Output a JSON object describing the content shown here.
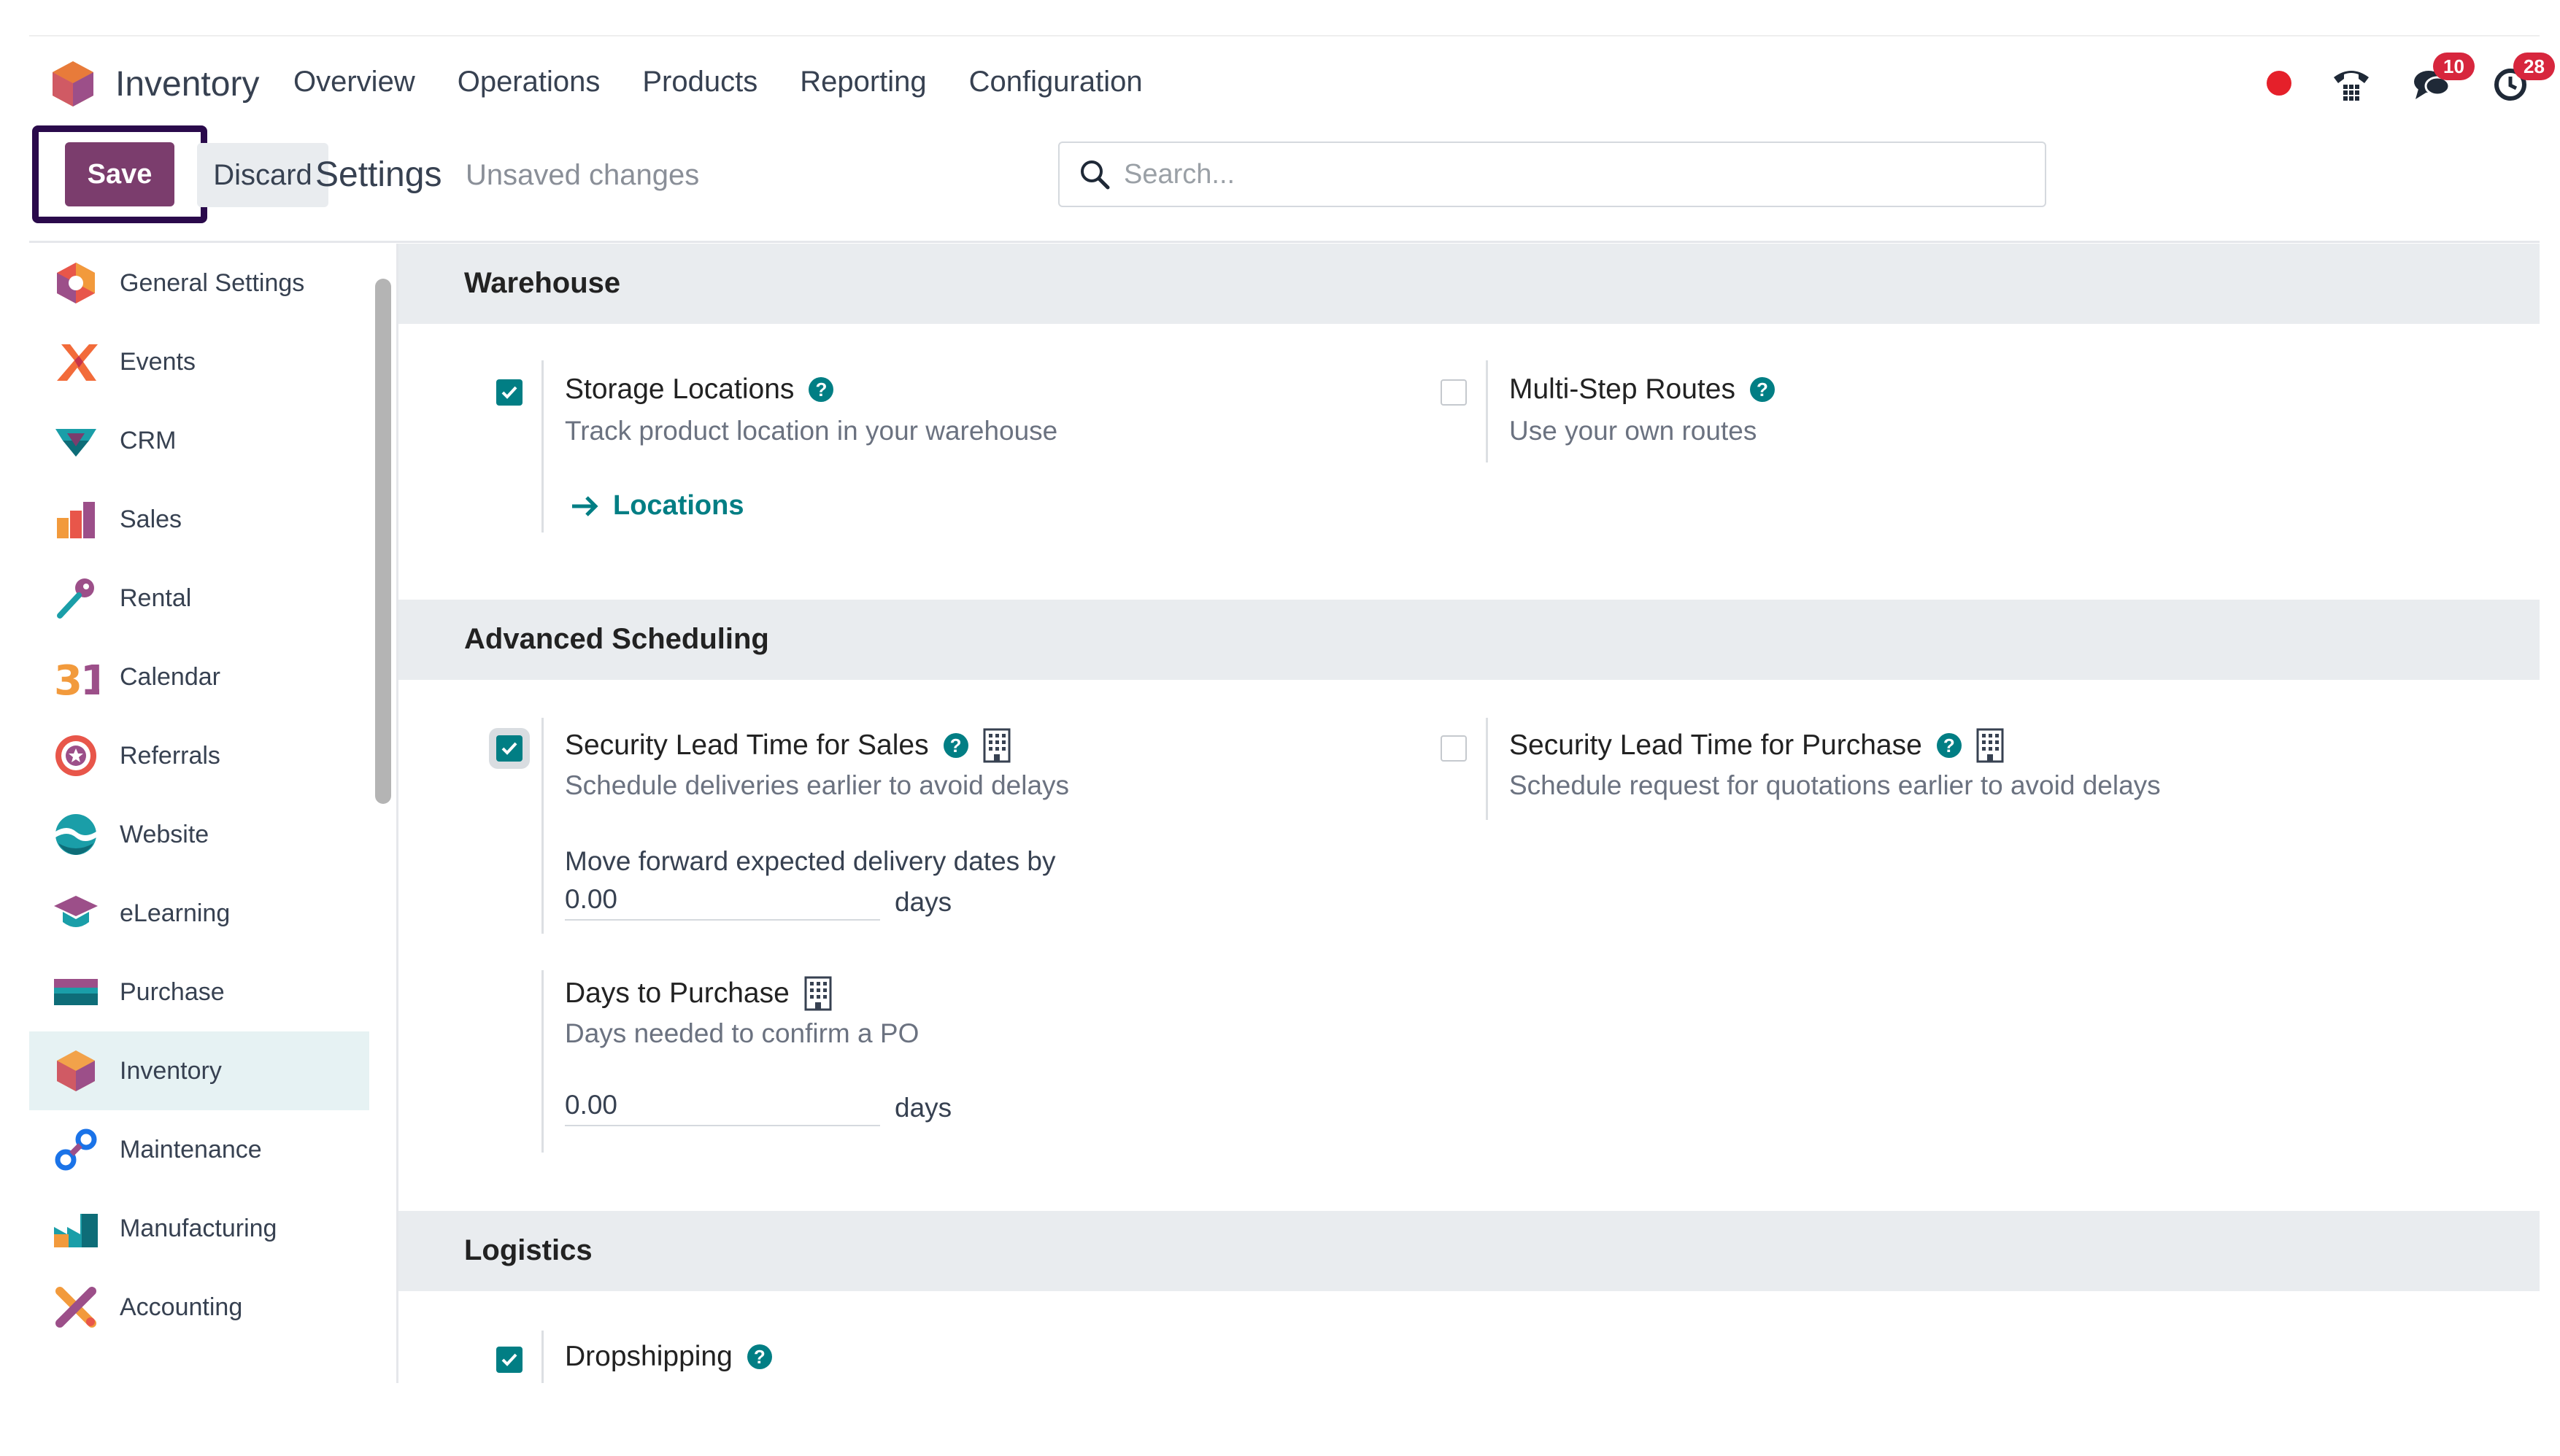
{
  "navbar": {
    "app_name": "Inventory",
    "menu": [
      "Overview",
      "Operations",
      "Products",
      "Reporting",
      "Configuration"
    ],
    "messages_badge": "10",
    "activities_badge": "28"
  },
  "control": {
    "save_label": "Save",
    "discard_label": "Discard",
    "title": "Settings",
    "status": "Unsaved changes",
    "search_placeholder": "Search..."
  },
  "sidebar": {
    "items": [
      {
        "label": "General Settings",
        "icon": "general-settings-icon"
      },
      {
        "label": "Events",
        "icon": "events-icon"
      },
      {
        "label": "CRM",
        "icon": "crm-icon"
      },
      {
        "label": "Sales",
        "icon": "sales-icon"
      },
      {
        "label": "Rental",
        "icon": "rental-icon"
      },
      {
        "label": "Calendar",
        "icon": "calendar-icon"
      },
      {
        "label": "Referrals",
        "icon": "referrals-icon"
      },
      {
        "label": "Website",
        "icon": "website-icon"
      },
      {
        "label": "eLearning",
        "icon": "elearning-icon"
      },
      {
        "label": "Purchase",
        "icon": "purchase-icon"
      },
      {
        "label": "Inventory",
        "icon": "inventory-icon"
      },
      {
        "label": "Maintenance",
        "icon": "maintenance-icon"
      },
      {
        "label": "Manufacturing",
        "icon": "manufacturing-icon"
      },
      {
        "label": "Accounting",
        "icon": "accounting-icon"
      }
    ],
    "active": "Inventory"
  },
  "sections": {
    "warehouse": {
      "title": "Warehouse",
      "storage_locations": {
        "title": "Storage Locations",
        "desc": "Track product location in your warehouse",
        "checked": true,
        "link": "Locations"
      },
      "multi_step_routes": {
        "title": "Multi-Step Routes",
        "desc": "Use your own routes",
        "checked": false
      }
    },
    "advanced_scheduling": {
      "title": "Advanced Scheduling",
      "lead_time_sales": {
        "title": "Security Lead Time for Sales",
        "desc": "Schedule deliveries earlier to avoid delays",
        "checked": true,
        "field_label": "Move forward expected delivery dates by",
        "value": "0.00",
        "unit": "days"
      },
      "lead_time_purchase": {
        "title": "Security Lead Time for Purchase",
        "desc": "Schedule request for quotations earlier to avoid delays",
        "checked": false
      },
      "days_to_purchase": {
        "title": "Days to Purchase",
        "desc": "Days needed to confirm a PO",
        "value": "0.00",
        "unit": "days"
      }
    },
    "logistics": {
      "title": "Logistics",
      "dropshipping": {
        "title": "Dropshipping",
        "checked": true
      }
    }
  },
  "colors": {
    "primary": "#7b3d6d",
    "accent": "#017e84",
    "badge": "#d7263d",
    "highlight_border": "#2a0a4b"
  }
}
